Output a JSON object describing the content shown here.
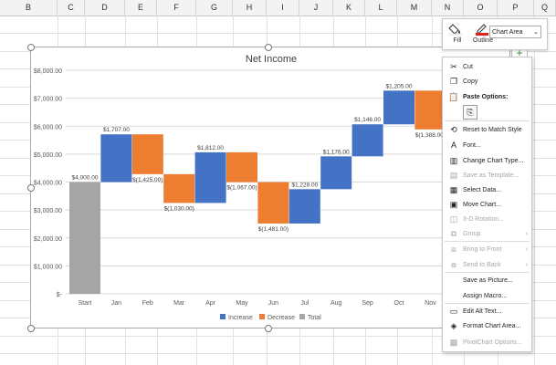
{
  "columns": [
    "B",
    "C",
    "D",
    "E",
    "F",
    "G",
    "H",
    "I",
    "J",
    "K",
    "L",
    "M",
    "N",
    "O",
    "P",
    "Q"
  ],
  "chart_data": {
    "type": "waterfall",
    "title": "Net Income",
    "categories": [
      "Start",
      "Jan",
      "Feb",
      "Mar",
      "Apr",
      "May",
      "Jun",
      "Jul",
      "Aug",
      "Sep",
      "Oct",
      "Nov"
    ],
    "values": [
      4000,
      1707,
      -1425,
      -1030,
      1812,
      -1067,
      -1481,
      1228,
      1176,
      1146,
      1205,
      -1388
    ],
    "kinds": [
      "total",
      "increase",
      "decrease",
      "decrease",
      "increase",
      "decrease",
      "decrease",
      "increase",
      "increase",
      "increase",
      "increase",
      "decrease"
    ],
    "data_labels": [
      "$4,000.00",
      "$1,707.00",
      "$(1,425.00)",
      "$(1,030.00)",
      "$1,812.00",
      "$(1,067.00)",
      "$(1,481.00)",
      "$1,228.00",
      "$1,176.00",
      "$1,146.00",
      "$1,205.00",
      "$(1,388.00)"
    ],
    "y_ticks": [
      "$-",
      "$1,000.00",
      "$2,000.00",
      "$3,000.00",
      "$4,000.00",
      "$5,000.00",
      "$6,000.00",
      "$7,000.00",
      "$8,000.00"
    ],
    "ylim": [
      0,
      8000
    ],
    "grid": true,
    "legend": [
      "Increase",
      "Decrease",
      "Total"
    ],
    "legend_position": "bottom",
    "colors": {
      "increase": "#4472c4",
      "decrease": "#ed7d31",
      "total": "#a5a5a5"
    }
  },
  "toolbar": {
    "fill_label": "Fill",
    "outline_label": "Outline",
    "chart_area_value": "Chart Area",
    "outline_color": "#e02020"
  },
  "context_menu": {
    "items": [
      {
        "label": "Cut",
        "icon": "scissors-icon",
        "glyph": "✂",
        "disabled": false
      },
      {
        "label": "Copy",
        "icon": "copy-icon",
        "glyph": "❐",
        "disabled": false
      },
      {
        "label": "Paste Options:",
        "icon": "paste-icon",
        "glyph": "📋",
        "disabled": false
      },
      {
        "label": "Reset to Match Style",
        "icon": "reset-style-icon",
        "glyph": "⟲",
        "disabled": false
      },
      {
        "label": "Font...",
        "icon": "font-icon",
        "glyph": "A",
        "disabled": false
      },
      {
        "label": "Change Chart Type...",
        "icon": "chart-type-icon",
        "glyph": "▥",
        "disabled": false
      },
      {
        "label": "Save as Template...",
        "icon": "template-icon",
        "glyph": "▤",
        "disabled": true
      },
      {
        "label": "Select Data...",
        "icon": "select-data-icon",
        "glyph": "▦",
        "disabled": false
      },
      {
        "label": "Move Chart...",
        "icon": "move-chart-icon",
        "glyph": "▣",
        "disabled": false
      },
      {
        "label": "3-D Rotation...",
        "icon": "rotation-icon",
        "glyph": "◫",
        "disabled": true
      },
      {
        "label": "Group",
        "icon": "group-icon",
        "glyph": "⧉",
        "disabled": true
      },
      {
        "label": "Bring to Front",
        "icon": "bring-front-icon",
        "glyph": "⧈",
        "disabled": true
      },
      {
        "label": "Send to Back",
        "icon": "send-back-icon",
        "glyph": "⧇",
        "disabled": true
      },
      {
        "label": "Save as Picture...",
        "icon": "",
        "glyph": "",
        "disabled": false
      },
      {
        "label": "Assign Macro...",
        "icon": "",
        "glyph": "",
        "disabled": false
      },
      {
        "label": "Edit Alt Text...",
        "icon": "alt-text-icon",
        "glyph": "▭",
        "disabled": false
      },
      {
        "label": "Format Chart Area...",
        "icon": "format-icon",
        "glyph": "◈",
        "disabled": false
      },
      {
        "label": "PivotChart Options...",
        "icon": "pivot-icon",
        "glyph": "▩",
        "disabled": true
      }
    ],
    "paste_sub_icon": "clipboard-icon"
  }
}
